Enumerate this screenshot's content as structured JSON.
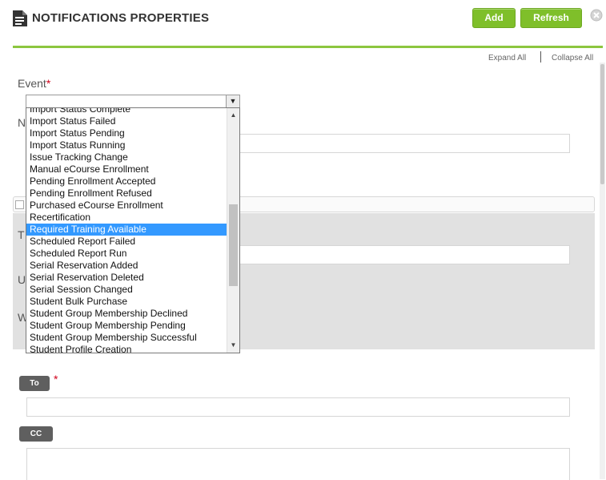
{
  "header": {
    "title": "NOTIFICATIONS PROPERTIES",
    "add_label": "Add",
    "refresh_label": "Refresh",
    "icon": "document-icon",
    "close_icon": "close-icon"
  },
  "links": {
    "expand_all": "Expand All",
    "collapse_all": "Collapse All"
  },
  "form": {
    "event_label": "Event",
    "required_mark": "*",
    "name_initial": "N",
    "t_initial": "T",
    "u_initial": "U",
    "w_initial": "W",
    "to_label": "To",
    "cc_label": "CC"
  },
  "dropdown": {
    "options": [
      "Import Status Complete",
      "Import Status Failed",
      "Import Status Pending",
      "Import Status Running",
      "Issue Tracking Change",
      "Manual eCourse Enrollment",
      "Pending Enrollment Accepted",
      "Pending Enrollment Refused",
      "Purchased eCourse Enrollment",
      "Recertification",
      "Required Training Available",
      "Scheduled Report Failed",
      "Scheduled Report Run",
      "Serial Reservation Added",
      "Serial Reservation Deleted",
      "Serial Session Changed",
      "Student Bulk Purchase",
      "Student Group Membership Declined",
      "Student Group Membership Pending",
      "Student Group Membership Successful",
      "Student Profile Creation"
    ],
    "selected": "Required Training Available"
  },
  "colors": {
    "accent_green": "#7fbf2a",
    "selection_blue": "#3399ff"
  }
}
